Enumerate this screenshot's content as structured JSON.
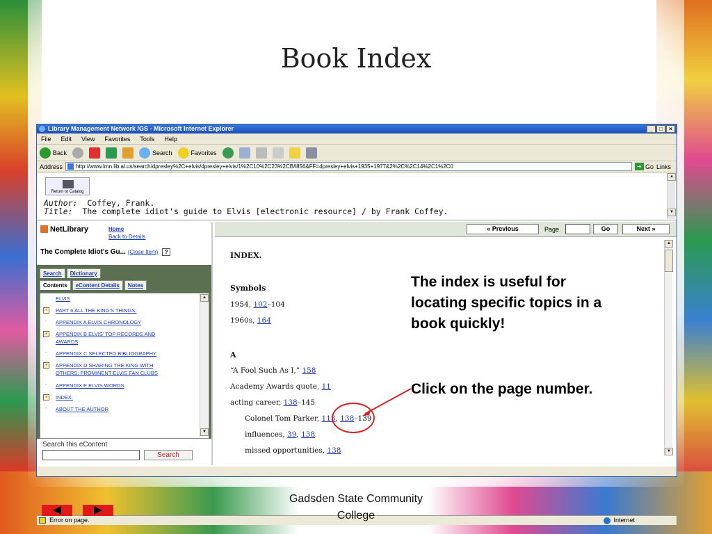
{
  "slide": {
    "title": "Book Index",
    "callout_1": [
      "The index is useful for",
      "locating specific topics in a",
      "book quickly!"
    ],
    "callout_2": "Click on the page number.",
    "footer": [
      "Gadsden State Community",
      "College"
    ],
    "accent_color": "#e02020"
  },
  "browser": {
    "window_title": "Library Management Network /GS - Microsoft Internet Explorer",
    "menu": [
      "File",
      "Edit",
      "View",
      "Favorites",
      "Tools",
      "Help"
    ],
    "toolbar": {
      "back": "Back",
      "search": "Search",
      "favorites": "Favorites"
    },
    "address_label": "Address",
    "address_value": "http://www.lmn.lib.al.us/search/dpresley%2C+elvis/dpresley+elvis/1%2C10%2C23%2CB/l856&FF=dpresley+elvis+1935+1977&2%2C%2C14%2C1%2C0",
    "go": "Go",
    "links": "Links",
    "status": "Error on page.",
    "zone": "Internet"
  },
  "catalog": {
    "return_label": "Return to Catalog",
    "author_label": "Author:",
    "author": "Coffey, Frank.",
    "title_label": "Title:",
    "title": "The complete idiot's guide to Elvis [electronic resource] / by Frank Coffey."
  },
  "sidebar": {
    "logo": "NetLibrary",
    "home": "Home",
    "back_to_details": "Back to Details",
    "book_title": "The Complete Idiot's Gu...",
    "close_item": "(Close Item)",
    "tabs_top": [
      "Search",
      "Dictionary"
    ],
    "tabs_bottom": [
      "Contents",
      "eContent Details",
      "Notes"
    ],
    "toc": [
      {
        "mark": "plus",
        "lines": [
          "PART 6 ALL THE KING'S THINGS."
        ]
      },
      {
        "mark": "dash",
        "lines": [
          "APPENDIX A ELVIS CHRONOLOGY"
        ]
      },
      {
        "mark": "plus",
        "lines": [
          "APPENDIX B ELVIS' TOP RECORDS AND",
          "AWARDS"
        ]
      },
      {
        "mark": "dash",
        "lines": [
          "APPENDIX C SELECTED BIBLIOGRAPHY"
        ]
      },
      {
        "mark": "plus",
        "lines": [
          "APPENDIX D SHARING THE KING WITH",
          "OTHERS: PROMINENT ELVIS FAN CLUBS"
        ]
      },
      {
        "mark": "dash",
        "lines": [
          "APPENDIX E ELVIS WORDS"
        ]
      },
      {
        "mark": "plus",
        "lines": [
          "INDEX."
        ]
      },
      {
        "mark": "dash",
        "lines": [
          "ABOUT THE AUTHOR"
        ]
      }
    ],
    "toc_top_partial": "ELVIS",
    "search_label": "Search this eContent",
    "search_button": "Search"
  },
  "reader": {
    "previous": "« Previous",
    "page_label": "Page",
    "go": "Go",
    "next": "Next »",
    "heading": "INDEX.",
    "symbols_heading": "Symbols",
    "a_heading": "A",
    "entries": {
      "e1954": {
        "text": "1954, ",
        "link": "102",
        "rest": "–104"
      },
      "e1960s": {
        "text": "1960s, ",
        "link": "164",
        "rest": ""
      },
      "fool": {
        "text": "“A Fool Such As I,” ",
        "link": "158",
        "rest": ""
      },
      "academy": {
        "text": "Academy Awards quote, ",
        "link": "11",
        "rest": ""
      },
      "acting": {
        "text": "acting career, ",
        "link": "138",
        "rest": "–145"
      },
      "parker": {
        "text": "Colonel Tom Parker, ",
        "link": "113",
        "sep": ", ",
        "link2": "138",
        "rest": "–139"
      },
      "influences": {
        "text": "influences, ",
        "link": "39",
        "sep": ", ",
        "link2": "138",
        "rest": ""
      },
      "missed": {
        "text": "missed opportunities, ",
        "link": "138",
        "rest": ""
      }
    }
  }
}
